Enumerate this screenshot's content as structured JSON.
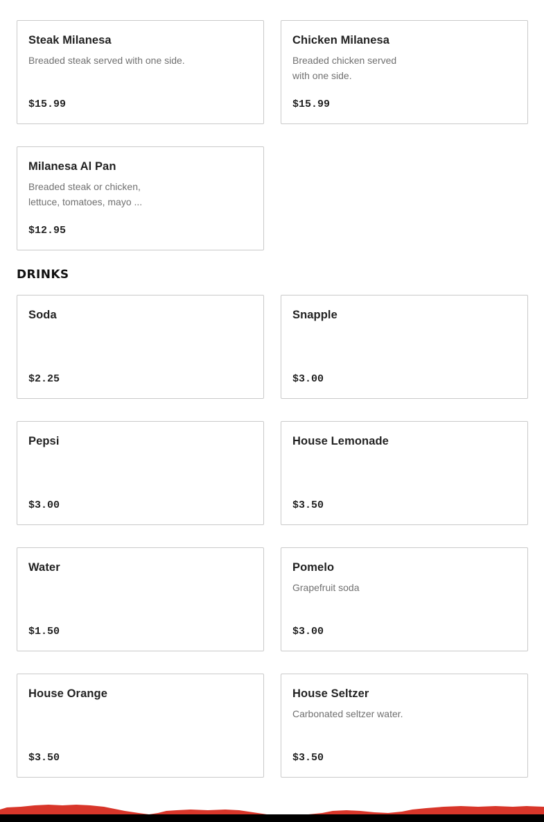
{
  "milanesas": {
    "items": [
      {
        "name": "Steak Milanesa",
        "desc_lines": [
          "Breaded steak served with one side."
        ],
        "price": "$15.99"
      },
      {
        "name": "Chicken Milanesa",
        "desc_lines": [
          "Breaded chicken served",
          "with one side."
        ],
        "price": "$15.99"
      },
      {
        "name": "Milanesa Al Pan",
        "desc_lines": [
          "Breaded steak or chicken,",
          "lettuce, tomatoes, mayo ..."
        ],
        "price": "$12.95"
      }
    ]
  },
  "drinks": {
    "title": "DRINKS",
    "items": [
      {
        "name": "Soda",
        "desc_lines": [],
        "price": "$2.25"
      },
      {
        "name": "Snapple",
        "desc_lines": [],
        "price": "$3.00"
      },
      {
        "name": "Pepsi",
        "desc_lines": [],
        "price": "$3.00"
      },
      {
        "name": "House Lemonade",
        "desc_lines": [],
        "price": "$3.50"
      },
      {
        "name": "Water",
        "desc_lines": [],
        "price": "$1.50"
      },
      {
        "name": "Pomelo",
        "desc_lines": [
          "Grapefruit soda"
        ],
        "price": "$3.00"
      },
      {
        "name": "House Orange",
        "desc_lines": [],
        "price": "$3.50"
      },
      {
        "name": "House Seltzer",
        "desc_lines": [
          "Carbonated seltzer water."
        ],
        "price": "$3.50"
      }
    ]
  },
  "colors": {
    "card_border": "#c9c9c9",
    "footer_red": "#d8362a",
    "footer_black": "#000000"
  }
}
